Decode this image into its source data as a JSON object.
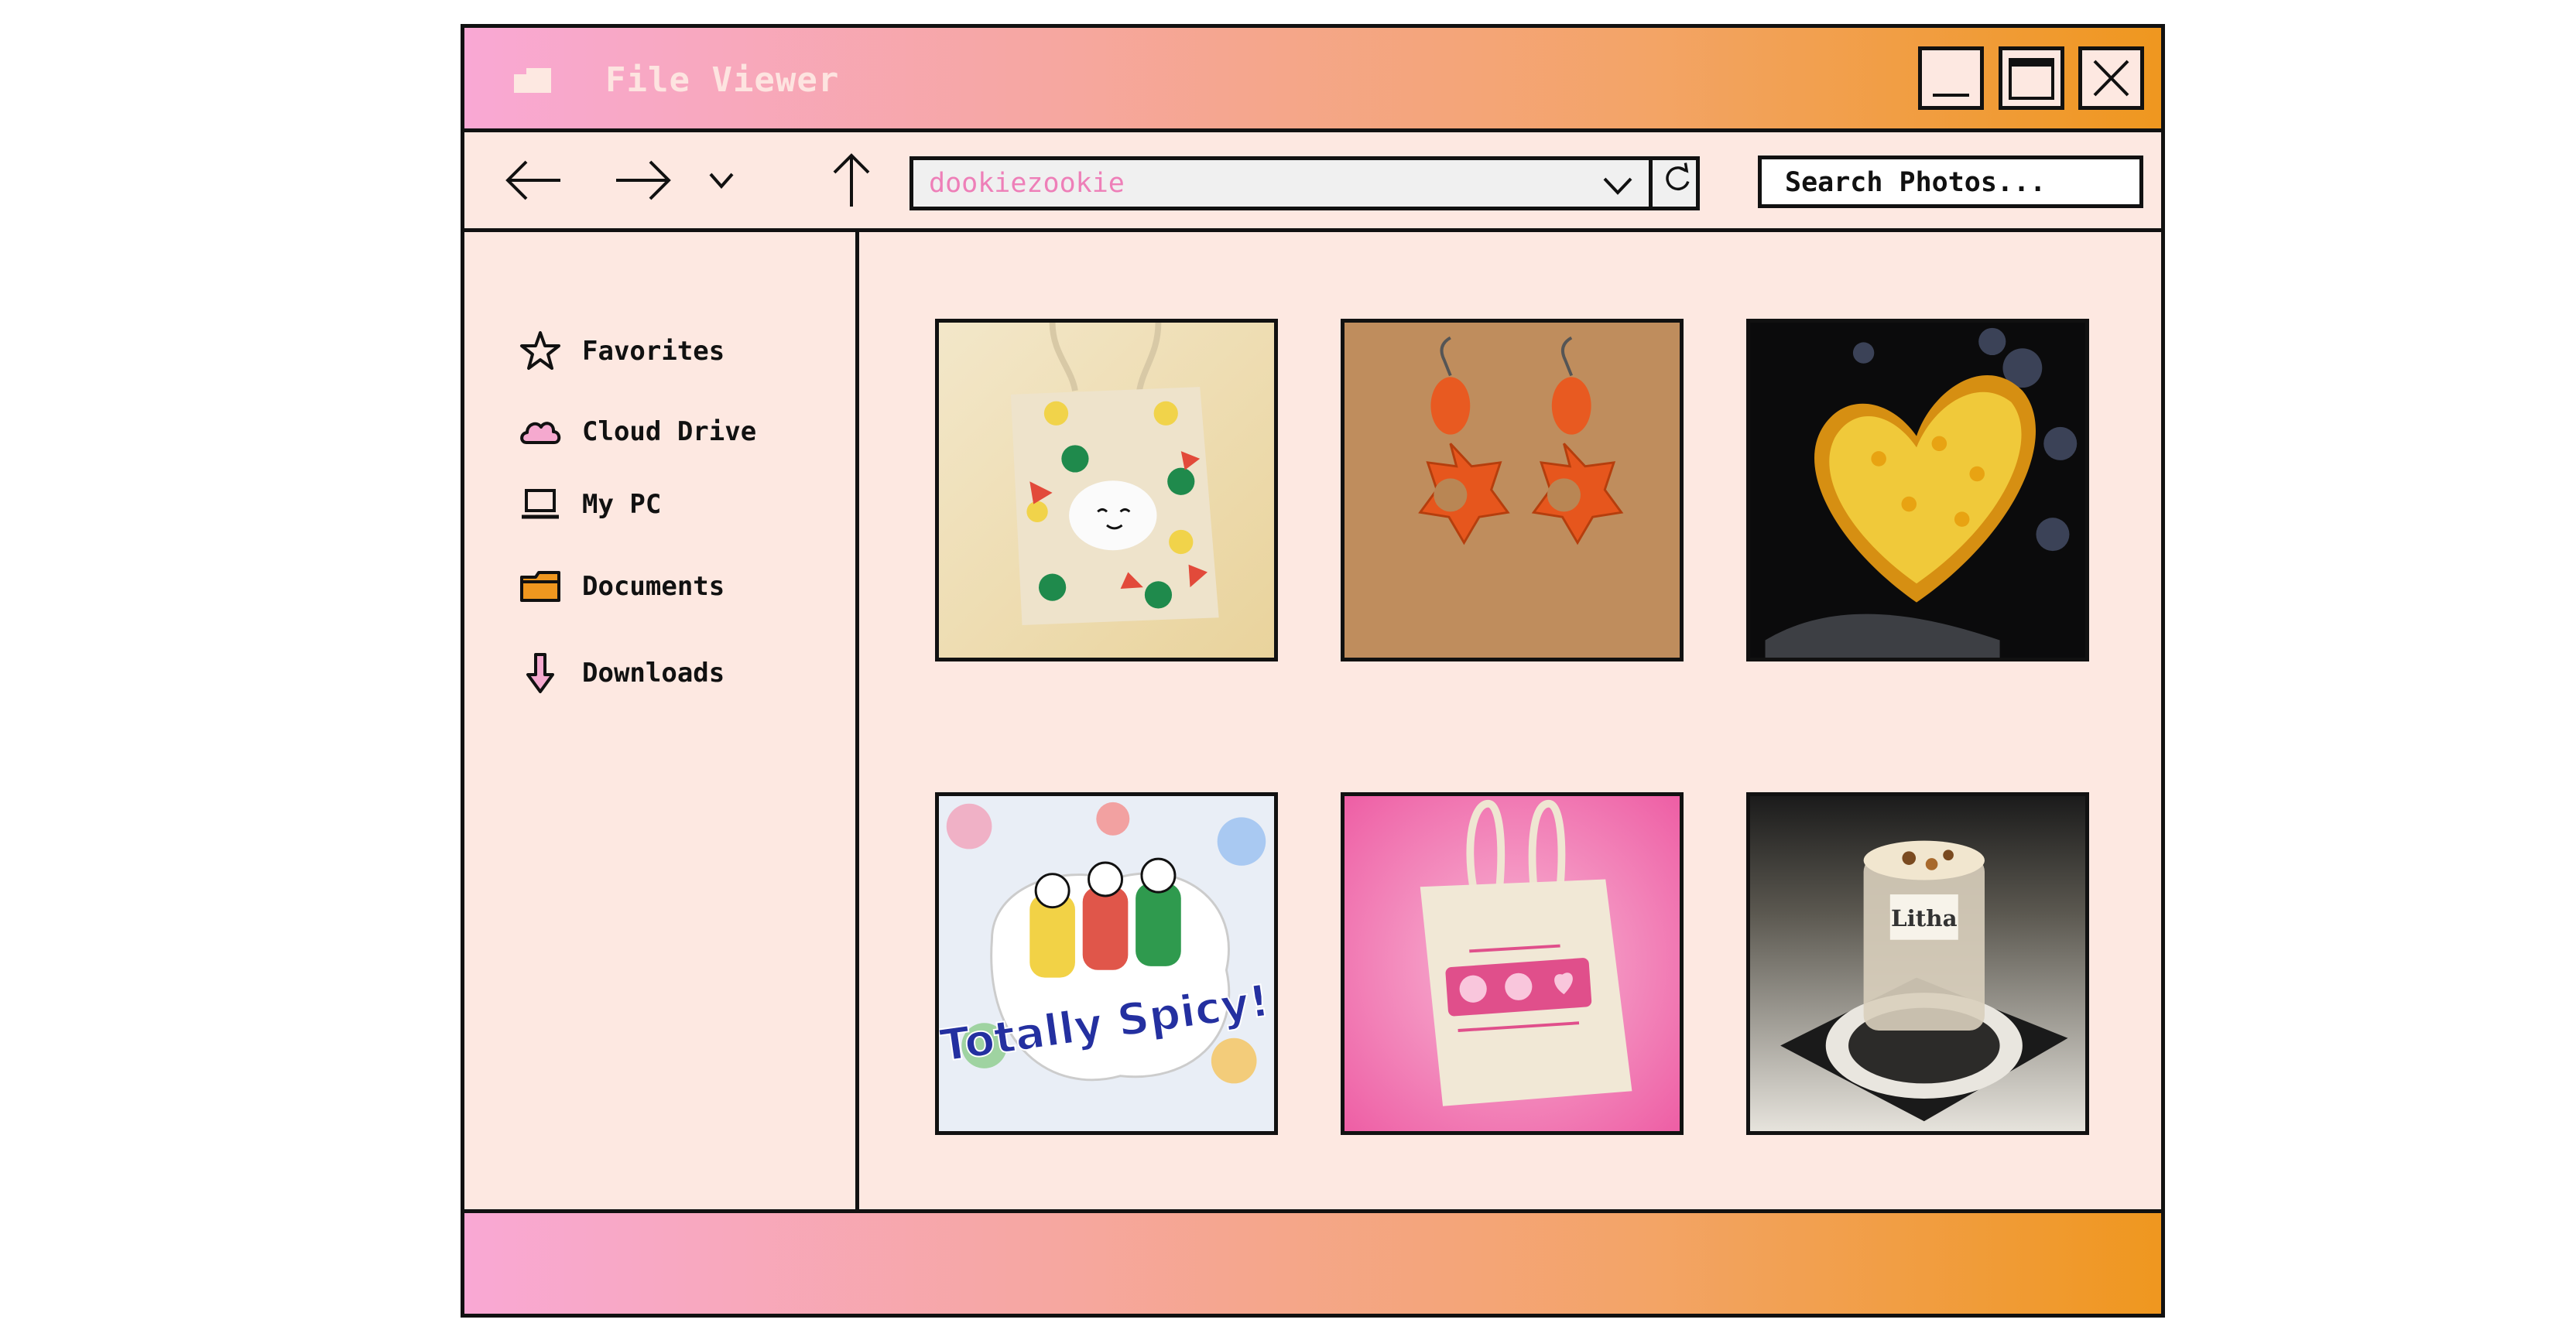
{
  "window": {
    "title": "File Viewer",
    "controls": [
      "minimize",
      "maximize",
      "close"
    ]
  },
  "toolbar": {
    "address_value": "dookiezookie",
    "search_placeholder": "Search Photos..."
  },
  "sidebar": {
    "items": [
      {
        "label": "Favorites",
        "icon": "star-icon"
      },
      {
        "label": "Cloud Drive",
        "icon": "cloud-icon"
      },
      {
        "label": "My PC",
        "icon": "laptop-icon"
      },
      {
        "label": "Documents",
        "icon": "folder-icon"
      },
      {
        "label": "Downloads",
        "icon": "download-arrow-icon"
      }
    ]
  },
  "gallery": {
    "photos": [
      {
        "subject": "tote-bag-character"
      },
      {
        "subject": "orange-flower-earrings"
      },
      {
        "subject": "yellow-heart-dish"
      },
      {
        "subject": "totally-spicy-sticker"
      },
      {
        "subject": "pink-tote-bag"
      },
      {
        "subject": "candle-on-coaster"
      }
    ],
    "sticker_text": "Totally Spicy!",
    "candle_label": "Litha"
  },
  "colors": {
    "gradient_start": "#f9a8d4",
    "gradient_end": "#ef971f",
    "panel_bg": "#fde8e1",
    "address_text": "#ee7fb8",
    "outline": "#111111"
  }
}
